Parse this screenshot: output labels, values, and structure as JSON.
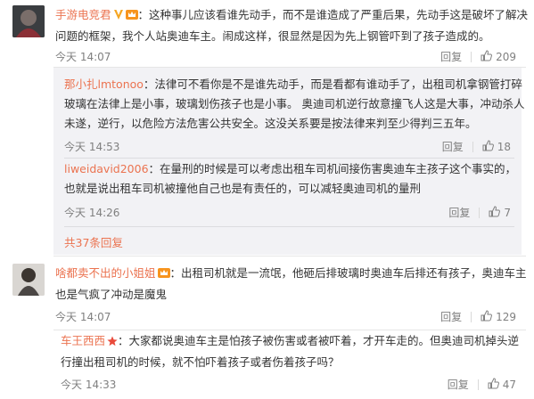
{
  "comments": [
    {
      "user": "手游电竞君",
      "lines": [
        "：这种事儿应该看谁先动手，而不是谁造成了严重后果，先动手这是破坏了解决",
        "问题的框架，我个人站奥迪车主。闹成这样，很显然是因为先上钢管吓到了孩子造成的。"
      ],
      "time": "今天 14:07",
      "reply": "回复",
      "likes": "209"
    },
    {
      "user": "啥都卖不出的小姐姐",
      "lines": [
        "：出租司机就是一流氓，他砸后排玻璃时奥迪车后排还有孩子，奥迪车主",
        "也是气疯了冲动是魔鬼"
      ],
      "time": "今天 14:07",
      "reply": "回复",
      "likes": "129"
    },
    {
      "user": "车王西西",
      "lines": [
        "：大家都说奥迪车主是怕孩子被伤害或者被吓着，才开车走的。但奥迪司机掉头逆",
        "行撞出租司机的时候，就不怕吓着孩子或者伤着孩子吗？"
      ],
      "time": "今天 14:33",
      "reply": "回复",
      "likes": "47"
    }
  ],
  "replies": [
    {
      "user": "那小扎lmtonoo",
      "lines": [
        "：法律可不看你是不是谁先动手，而是看都有谁动手了，出租司机拿钢管打碎",
        "玻璃在法律上是小事，玻璃划伤孩子也是小事。 奥迪司机逆行故意撞飞人这是大事，冲动杀人",
        "未遂，逆行，以危险方法危害公共安全。这没关系要是按法律来判至少得判三五年。"
      ],
      "time": "今天 14:53",
      "reply": "回复",
      "likes": "18"
    },
    {
      "user": "liweidavid2006",
      "lines": [
        "：在量刑的时候是可以考虑出租车司机间接伤害奥迪车主孩子这个事实的，",
        "也就是说出租车司机被撞他自己也是有责任的，可以减轻奥迪司机的量刑"
      ],
      "time": "今天 14:26",
      "reply": "回复",
      "likes": "7"
    }
  ],
  "more_replies": "共37条回复",
  "icons": {
    "like": "thumbs-up-icon",
    "verified": "verified-v-icon",
    "vip": "vip-crown-icon",
    "star": "star-icon"
  },
  "colors": {
    "username": "#eb7350",
    "verified": "#f5a623",
    "vip": "#f7941e",
    "star": "#e94b3c"
  }
}
